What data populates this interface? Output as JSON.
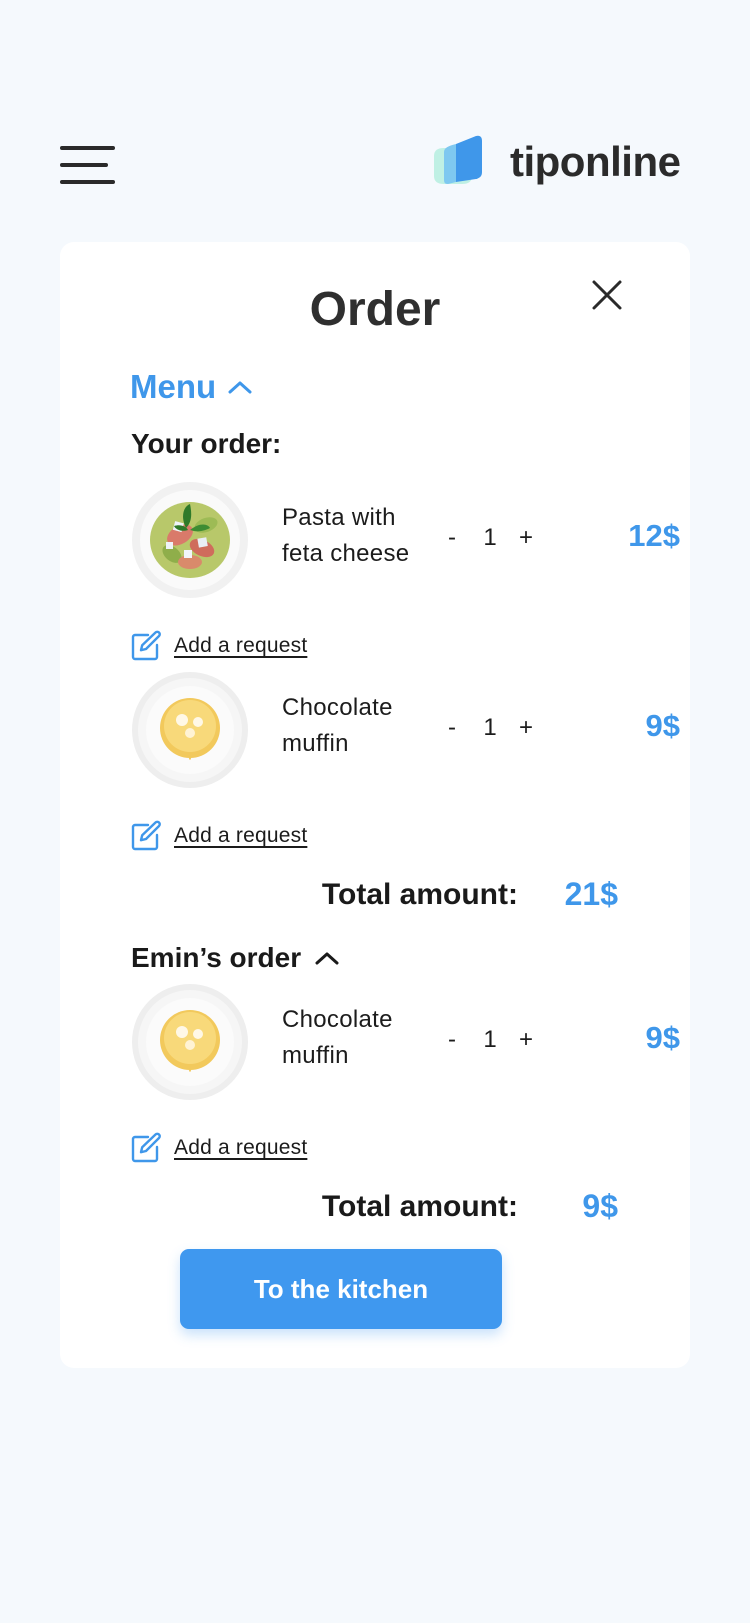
{
  "header": {
    "brand": "tiponline",
    "menu_icon": "hamburger-icon",
    "logo_icon": "speech-bubble-logo"
  },
  "panel": {
    "title": "Order",
    "close_icon": "close-icon",
    "menu_toggle": {
      "label": "Menu",
      "icon": "chevron-up-icon"
    },
    "your_order": {
      "label": "Your order:",
      "items": [
        {
          "name": "Pasta with feta cheese",
          "quantity": "1",
          "minus": "-",
          "plus": "+",
          "price": "12$",
          "request_label": "Add a request",
          "image": "pasta-plate"
        },
        {
          "name": "Chocolate muffin",
          "quantity": "1",
          "minus": "-",
          "plus": "+",
          "price": "9$",
          "request_label": "Add a request",
          "image": "muffin-plate"
        }
      ],
      "total_label": "Total amount:",
      "total_value": "21$"
    },
    "other_order": {
      "label": "Emin’s order",
      "icon": "chevron-up-icon",
      "items": [
        {
          "name": "Chocolate muffin",
          "quantity": "1",
          "minus": "-",
          "plus": "+",
          "price": "9$",
          "request_label": "Add a request",
          "image": "muffin-plate"
        }
      ],
      "total_label": "Total amount:",
      "total_value": "9$"
    },
    "submit_label": "To the kitchen"
  },
  "colors": {
    "accent": "#3f97ea",
    "button": "#3f98ef",
    "background": "#f5f9fd",
    "card": "#ffffff",
    "text": "#1c1c1c"
  }
}
